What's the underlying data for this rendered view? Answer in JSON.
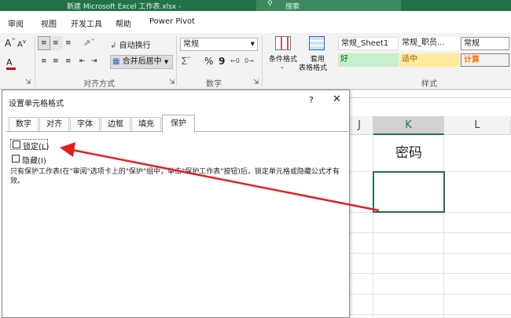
{
  "title_bar": {
    "document_title": "新建 Microsoft Excel 工作表.xlsx  -",
    "search_placeholder": "搜索",
    "search_icon": "search-icon",
    "bg_color": "#217346"
  },
  "ribbon_tabs": [
    "审阅",
    "视图",
    "开发工具",
    "帮助",
    "Power Pivot"
  ],
  "ribbon": {
    "font_group": {
      "grow_font": "A",
      "shrink_font": "A",
      "font_color": "A"
    },
    "alignment_group": {
      "label": "对齐方式",
      "wrap_text": "自动换行",
      "merge_center": "合并后居中"
    },
    "number_group": {
      "label": "数字",
      "format_value": "常规",
      "percent": "%",
      "comma": "9"
    },
    "styles_group": {
      "label": "样式",
      "conditional_format": "条件格式",
      "format_as_table_line1": "套用",
      "format_as_table_line2": "表格格式",
      "cell_styles": [
        {
          "text": "常规_Sheet1",
          "bg": "#ffffff",
          "fg": "#000000"
        },
        {
          "text": "常规_职员...",
          "bg": "#ffffff",
          "fg": "#000000"
        },
        {
          "text": "常规",
          "bg": "#ffffff",
          "fg": "#000000"
        },
        {
          "text": "好",
          "bg": "#c6efce",
          "fg": "#006100"
        },
        {
          "text": "适中",
          "bg": "#ffeb9c",
          "fg": "#9c5700"
        },
        {
          "text": "计算",
          "bg": "#f2f2f2",
          "fg": "#fa7d00"
        }
      ]
    }
  },
  "sheet": {
    "columns": [
      "J",
      "K",
      "L"
    ],
    "selected_column": "K",
    "header_cell_text": "密码"
  },
  "dialog": {
    "title": "设置单元格格式",
    "help": "?",
    "close": "✕",
    "tabs": [
      "数字",
      "对齐",
      "字体",
      "边框",
      "填充",
      "保护"
    ],
    "active_tab": "保护",
    "locked_label": "锁定(L)",
    "locked_checked": false,
    "hidden_label": "隐藏(I)",
    "hidden_checked": false,
    "description": "只有保护工作表(在\"审阅\"选项卡上的\"保护\"组中，单击\"保护工作表\"按钮)后，锁定单元格或隐藏公式才有效。"
  },
  "annotation": {
    "arrow_color": "#e02020"
  }
}
